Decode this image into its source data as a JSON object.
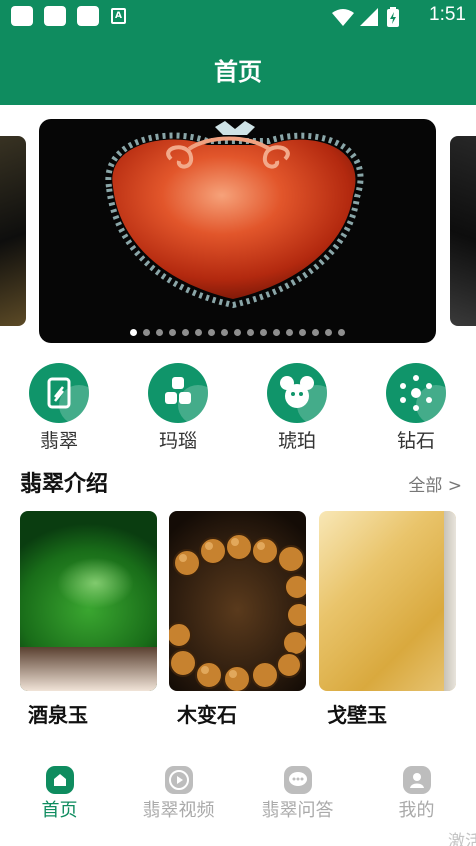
{
  "status_bar": {
    "time": "1:51",
    "notification_icons": [
      "app-icon",
      "app-icon",
      "app-icon",
      "a-icon"
    ],
    "system_icons": [
      "wifi-icon",
      "signal-icon",
      "battery-icon"
    ],
    "a_icon_glyph": "A"
  },
  "header": {
    "title": "首页"
  },
  "colors": {
    "brand": "#0f8c5f",
    "text": "#333333",
    "muted": "#aaaaaa"
  },
  "banner": {
    "slide_count": 17,
    "active_index": 0
  },
  "categories": [
    {
      "label": "翡翠",
      "icon": "jade-icon"
    },
    {
      "label": "玛瑙",
      "icon": "agate-icon"
    },
    {
      "label": "琥珀",
      "icon": "amber-icon"
    },
    {
      "label": "钻石",
      "icon": "diamond-icon"
    }
  ],
  "section": {
    "title": "翡翠介绍",
    "more": "全部 >"
  },
  "cards": [
    {
      "name": "酒泉玉"
    },
    {
      "name": "木变石"
    },
    {
      "name": "戈壁玉"
    }
  ],
  "nav": [
    {
      "label": "首页",
      "icon": "home-icon",
      "active": true
    },
    {
      "label": "翡翠视频",
      "icon": "video-icon",
      "active": false
    },
    {
      "label": "翡翠问答",
      "icon": "chat-icon",
      "active": false
    },
    {
      "label": "我的",
      "icon": "user-icon",
      "active": false
    }
  ],
  "watermark": "激活"
}
